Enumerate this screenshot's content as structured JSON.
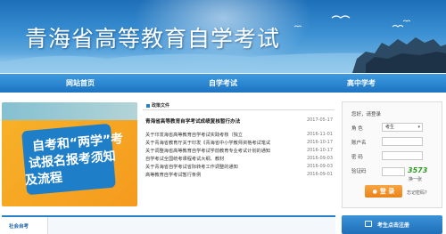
{
  "site": {
    "title": "青海省高等教育自学考试"
  },
  "nav": {
    "items": [
      {
        "label": "网站首页"
      },
      {
        "label": "自学考试"
      },
      {
        "label": "高中学考"
      }
    ]
  },
  "promo": {
    "line1": "自考和“两学”考",
    "line2": "试报名报考须知",
    "line3": "及流程"
  },
  "news": {
    "tab_label": "政策文件",
    "items": [
      {
        "title": "青海省高等教育自学考试成绩复核暂行办法",
        "date": "2017-05-17"
      },
      {
        "title": "关于印发海省高等教育自学考试实践考核（独立",
        "date": "2016-11-01"
      },
      {
        "title": "关于青海省教育厅关于印发《青海省中小学教师资格考试笔试",
        "date": "2016-10-17"
      },
      {
        "title": "关于调整海省高等教育自学考试学前教育专业考试计划的通知",
        "date": "2016-10-17"
      },
      {
        "title": "自学考试全国统考课程考试大纲、教材",
        "date": "2016-09-03"
      },
      {
        "title": "关于青海省自学考试省际转考工作调整的通知",
        "date": "2016-09-03"
      },
      {
        "title": "高等教育自学考试暂行条例",
        "date": "2016-09-01"
      }
    ]
  },
  "login": {
    "greeting": "您好，请登录",
    "role_label": "角 色",
    "role_value": "考生",
    "account_label": "账户名",
    "password_label": "密 码",
    "captcha_label": "验证码",
    "captcha_text": "3573",
    "refresh_label": "换一张",
    "login_button": "登 录",
    "forgot_link": "忘记密码?"
  },
  "section_bar": {
    "label": "社会自考"
  },
  "register_bar": {
    "label": "考生点击注册"
  },
  "colors": {
    "brand_blue": "#1d74c2",
    "accent_orange": "#e9821a",
    "captcha_green": "#2f9a22"
  }
}
